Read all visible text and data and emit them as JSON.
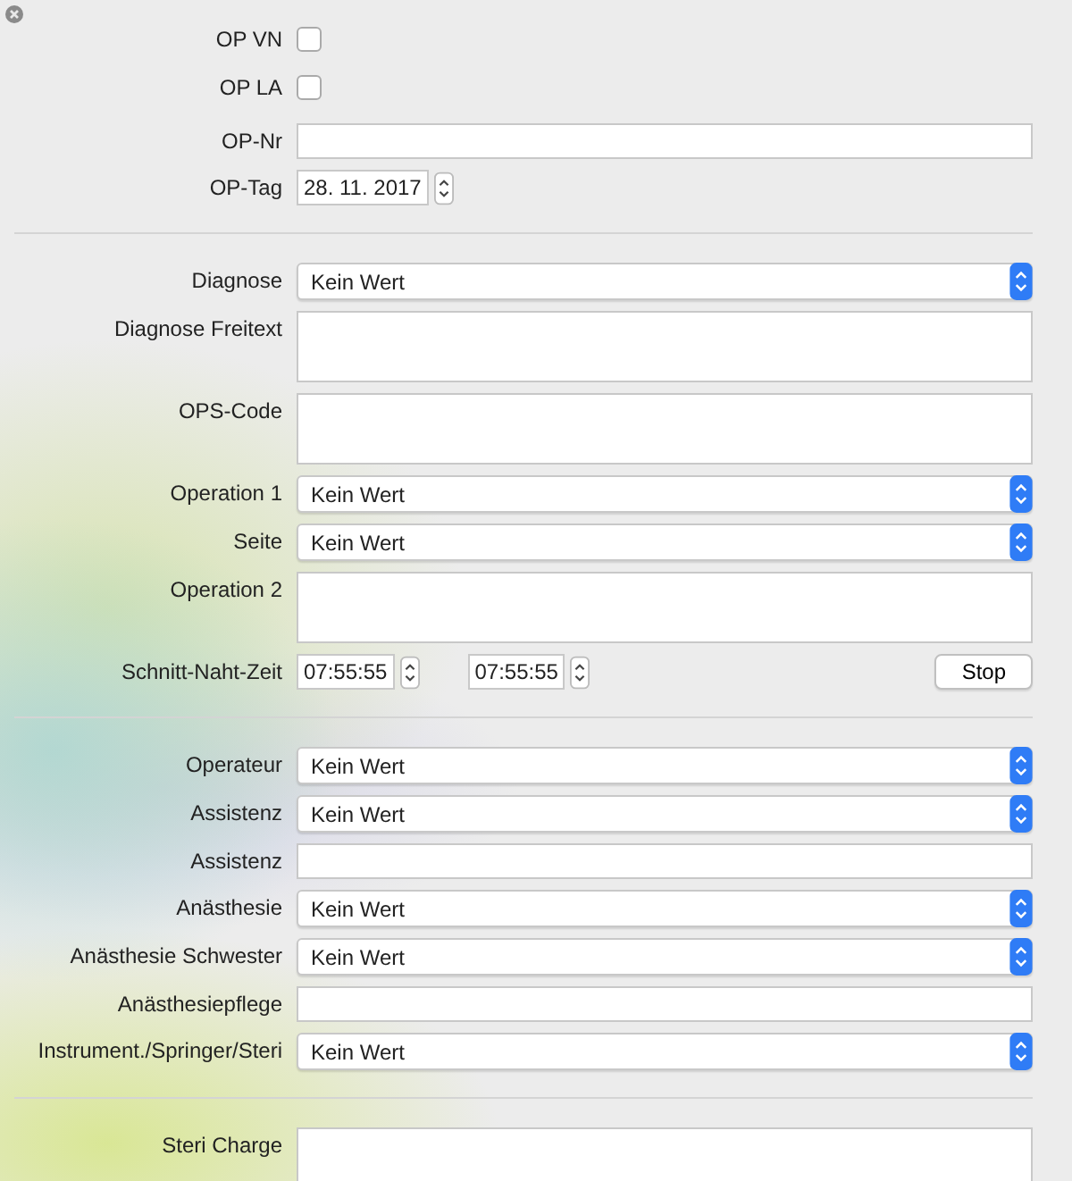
{
  "sections": [
    {
      "rows": [
        {
          "kind": "checkbox",
          "label": "OP VN",
          "checked": false
        },
        {
          "kind": "checkbox",
          "label": "OP LA",
          "checked": false
        },
        {
          "kind": "text",
          "label": "OP-Nr"
        },
        {
          "kind": "date",
          "label": "OP-Tag",
          "value": "28. 11. 2017"
        }
      ]
    },
    {
      "rows": [
        {
          "kind": "select",
          "label": "Diagnose",
          "value": "Kein Wert"
        },
        {
          "kind": "textarea",
          "label": "Diagnose Freitext"
        },
        {
          "kind": "textarea",
          "label": "OPS-Code"
        },
        {
          "kind": "select",
          "label": "Operation 1",
          "value": "Kein Wert"
        },
        {
          "kind": "select",
          "label": "Seite",
          "value": "Kein Wert"
        },
        {
          "kind": "textarea",
          "label": "Operation 2"
        },
        {
          "kind": "times",
          "label": "Schnitt-Naht-Zeit",
          "start": "07:55:55",
          "end": "07:55:55",
          "button": "Stop"
        }
      ]
    },
    {
      "rows": [
        {
          "kind": "select",
          "label": "Operateur",
          "value": "Kein Wert"
        },
        {
          "kind": "select",
          "label": "Assistenz",
          "value": "Kein Wert"
        },
        {
          "kind": "text",
          "label": "Assistenz"
        },
        {
          "kind": "select",
          "label": "Anästhesie",
          "value": "Kein Wert"
        },
        {
          "kind": "select",
          "label": "Anästhesie Schwester",
          "value": "Kein Wert"
        },
        {
          "kind": "text",
          "label": "Anästhesiepflege"
        },
        {
          "kind": "select",
          "label": "Instrument./Springer/Steri",
          "value": "Kein Wert"
        }
      ]
    },
    {
      "rows": [
        {
          "kind": "textarea",
          "label": "Steri Charge"
        }
      ]
    }
  ]
}
